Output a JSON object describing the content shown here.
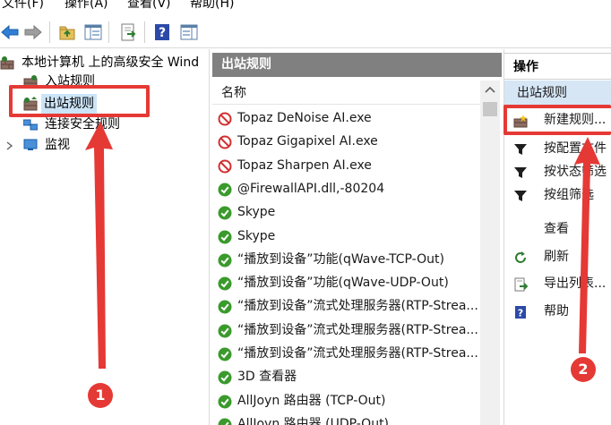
{
  "menu": {
    "items": [
      "文件(F)",
      "操作(A)",
      "查看(V)",
      "帮助(H)"
    ]
  },
  "tree": {
    "root": "本地计算机 上的高级安全 Wind",
    "items": [
      "入站规则",
      "出站规则",
      "连接安全规则",
      "监视"
    ],
    "selected": "出站规则"
  },
  "rules_pane": {
    "title": "出站规则",
    "column_name": "名称",
    "rows": [
      {
        "name": "Topaz DeNoise AI.exe",
        "status": "blocked"
      },
      {
        "name": "Topaz Gigapixel AI.exe",
        "status": "blocked"
      },
      {
        "name": "Topaz Sharpen AI.exe",
        "status": "blocked"
      },
      {
        "name": "@FirewallAPI.dll,-80204",
        "status": "allowed"
      },
      {
        "name": "Skype",
        "status": "allowed"
      },
      {
        "name": "Skype",
        "status": "allowed"
      },
      {
        "name": "“播放到设备”功能(qWave-TCP-Out)",
        "status": "allowed"
      },
      {
        "name": "“播放到设备”功能(qWave-UDP-Out)",
        "status": "allowed"
      },
      {
        "name": "“播放到设备”流式处理服务器(RTP-Strea...",
        "status": "allowed"
      },
      {
        "name": "“播放到设备”流式处理服务器(RTP-Strea...",
        "status": "allowed"
      },
      {
        "name": "“播放到设备”流式处理服务器(RTP-Strea...",
        "status": "allowed"
      },
      {
        "name": "3D 查看器",
        "status": "allowed"
      },
      {
        "name": "AllJoyn 路由器 (TCP-Out)",
        "status": "allowed"
      },
      {
        "name": "AllJoyn 路由器 (UDP-Out)",
        "status": "allowed"
      }
    ]
  },
  "actions_pane": {
    "title": "操作",
    "section": "出站规则",
    "items": [
      {
        "label": "新建规则...",
        "icon": "new-rule-icon"
      },
      {
        "label": "按配置文件",
        "icon": "filter-icon"
      },
      {
        "label": "按状态筛选",
        "icon": "filter-icon"
      },
      {
        "label": "按组筛选",
        "icon": "filter-icon"
      },
      {
        "label": "查看",
        "icon": ""
      },
      {
        "label": "刷新",
        "icon": "refresh-icon"
      },
      {
        "label": "导出列表...",
        "icon": "export-icon"
      },
      {
        "label": "帮助",
        "icon": "help-icon"
      }
    ]
  },
  "annotations": {
    "badge_1": "1",
    "badge_2": "2",
    "color": "#e53935"
  },
  "colors": {
    "blocked": "#d32f2f",
    "allowed": "#3a9a2c",
    "pane_header": "#808080",
    "section_bg": "#d6e6f5",
    "selection": "#cce4f7"
  }
}
